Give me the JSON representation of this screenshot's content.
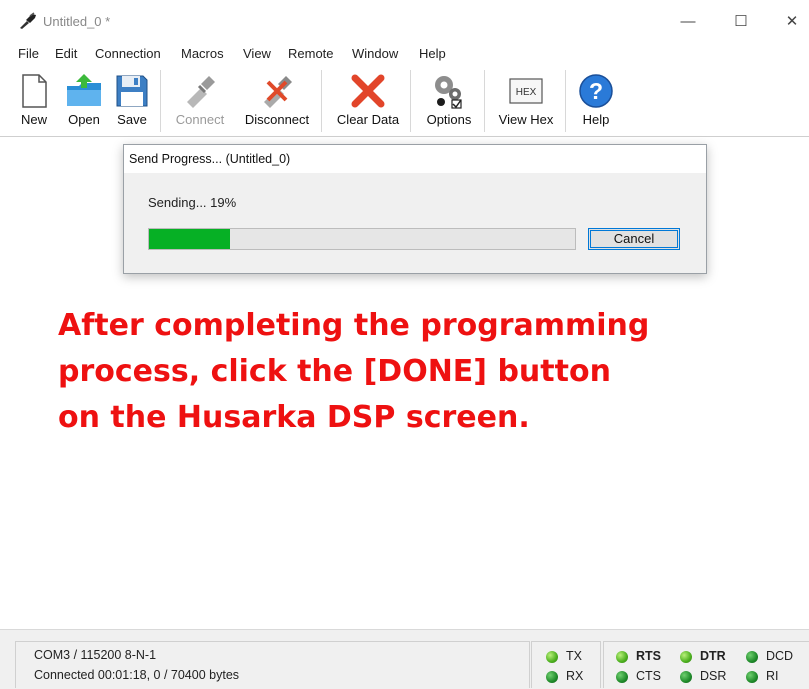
{
  "window": {
    "title": "Untitled_0 *"
  },
  "menu": [
    "File",
    "Edit",
    "Connection",
    "Macros",
    "View",
    "Remote",
    "Window",
    "Help"
  ],
  "toolbar": {
    "new": "New",
    "open": "Open",
    "save": "Save",
    "connect": "Connect",
    "disconnect": "Disconnect",
    "clear": "Clear Data",
    "options": "Options",
    "viewhex": "View Hex",
    "help": "Help",
    "hex_icon_text": "HEX"
  },
  "dialog": {
    "title": "Send Progress... (Untitled_0)",
    "status": "Sending...  19%",
    "progress_percent": 19,
    "cancel": "Cancel"
  },
  "instruction": [
    "After completing the programming",
    "process, click the [DONE] button",
    "on the Husarka DSP screen."
  ],
  "status": {
    "port": "COM3 / 115200 8-N-1",
    "connection": "Connected 00:01:18, 0 / 70400 bytes",
    "leds": {
      "tx": "TX",
      "rx": "RX",
      "rts": "RTS",
      "cts": "CTS",
      "dtr": "DTR",
      "dsr": "DSR",
      "dcd": "DCD",
      "ri": "RI"
    }
  },
  "colors": {
    "instruction": "#ee1111",
    "progress": "#06b025",
    "accent": "#0078d7"
  }
}
